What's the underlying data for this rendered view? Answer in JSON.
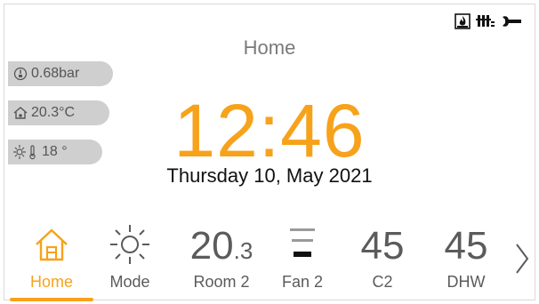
{
  "header": {
    "title": "Home",
    "status_icons": [
      "fire-icon",
      "radiator-icon",
      "wrench-icon"
    ]
  },
  "readings": {
    "pressure": "0.68bar",
    "indoor_temp": "20.3°C",
    "outdoor_temp": "18 °"
  },
  "clock": {
    "time": "12:46",
    "date": "Thursday 10, May 2021"
  },
  "nav": {
    "items": [
      {
        "label": "Home",
        "icon": "home-icon",
        "active": true
      },
      {
        "label": "Mode",
        "icon": "sun-icon"
      },
      {
        "label": "Room 2",
        "value_main": "20",
        "value_sub": ".3"
      },
      {
        "label": "Fan 2",
        "icon": "fan-level-icon"
      },
      {
        "label": "C2",
        "value_main": "45"
      },
      {
        "label": "DHW",
        "value_main": "45"
      }
    ],
    "next": "chevron-right-icon"
  },
  "colors": {
    "accent": "#f7a21b",
    "pill": "#cfcfcf",
    "text": "#5b5b5b"
  }
}
